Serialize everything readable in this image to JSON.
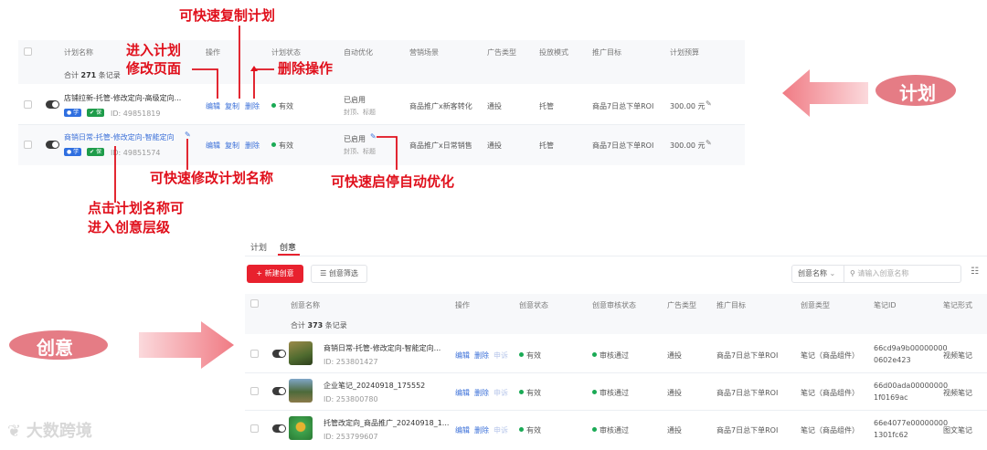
{
  "plan_table": {
    "headers": [
      "计划名称",
      "操作",
      "计划状态",
      "自动优化",
      "营销场景",
      "广告类型",
      "投放模式",
      "推广目标",
      "计划预算"
    ],
    "total_prefix": "合计",
    "total_count": "271",
    "total_suffix": "条记录",
    "rows": [
      {
        "name": "店铺拉新-托管-修改定向-高级定向...",
        "badge1": "学",
        "badge2": "保",
        "id": "ID: 49851819",
        "op_edit": "编辑",
        "op_copy": "复制",
        "op_delete": "删除",
        "status": "有效",
        "auto_opt": "已启用",
        "auto_opt_sub": "封顶、标题",
        "scene": "商品推广x新客转化",
        "ad_type": "通投",
        "mode": "托管",
        "target": "商品7日总下单ROI",
        "budget": "300.00 元"
      },
      {
        "name": "商销日常-托管-修改定向-智能定向",
        "badge1": "学",
        "badge2": "保",
        "id": "ID: 49851574",
        "op_edit": "编辑",
        "op_copy": "复制",
        "op_delete": "删除",
        "status": "有效",
        "auto_opt": "已启用",
        "auto_opt_sub": "封顶、标题",
        "scene": "商品推广x日常销售",
        "ad_type": "通投",
        "mode": "托管",
        "target": "商品7日总下单ROI",
        "budget": "300.00 元"
      }
    ]
  },
  "annotations": {
    "copy_plan": "可快速复制计划",
    "enter_edit_1": "进入计划",
    "enter_edit_2": "修改页面",
    "delete_op": "删除操作",
    "rename_plan": "可快速修改计划名称",
    "toggle_auto": "可快速启停自动优化",
    "click_name_1": "点击计划名称可",
    "click_name_2": "进入创意层级",
    "plan_label": "计划",
    "creative_label": "创意"
  },
  "creative_panel": {
    "tabs": [
      "计划",
      "创意"
    ],
    "new_button": "新建创意",
    "filter_button": "创意筛选",
    "search_field_select": "创意名称",
    "search_placeholder": "请输入创意名称",
    "headers": [
      "创意名称",
      "操作",
      "创意状态",
      "创意审核状态",
      "广告类型",
      "推广目标",
      "创意类型",
      "笔记ID",
      "笔记形式"
    ],
    "total_prefix": "合计",
    "total_count": "373",
    "total_suffix": "条记录",
    "rows": [
      {
        "name": "商销日常-托管-修改定向-智能定向...",
        "id": "ID: 253801427",
        "op_edit": "编辑",
        "op_delete": "删除",
        "op_appeal": "申诉",
        "status": "有效",
        "audit": "审核通过",
        "ad_type": "通投",
        "target": "商品7日总下单ROI",
        "ctype": "笔记（商品组件）",
        "note_id_1": "66cd9a9b00000000",
        "note_id_2": "0602e423",
        "note_form": "视频笔记"
      },
      {
        "name": "企业笔记_20240918_175552",
        "id": "ID: 253800780",
        "op_edit": "编辑",
        "op_delete": "删除",
        "op_appeal": "申诉",
        "status": "有效",
        "audit": "审核通过",
        "ad_type": "通投",
        "target": "商品7日总下单ROI",
        "ctype": "笔记（商品组件）",
        "note_id_1": "66d00ada00000000",
        "note_id_2": "1f0169ac",
        "note_form": "视频笔记"
      },
      {
        "name": "托管改定向_商品推广_20240918_1...",
        "id": "ID: 253799607",
        "op_edit": "编辑",
        "op_delete": "删除",
        "op_appeal": "申诉",
        "status": "有效",
        "audit": "审核通过",
        "ad_type": "通投",
        "target": "商品7日总下单ROI",
        "ctype": "笔记（商品组件）",
        "note_id_1": "66e4077e00000000",
        "note_id_2": "1301fc62",
        "note_form": "图文笔记"
      }
    ]
  },
  "watermark": "大数跨境",
  "colors": {
    "annotation_red": "#e0101c",
    "link_blue": "#3a6fd8",
    "primary_button": "#e8212e",
    "status_green": "#1aaa55"
  }
}
